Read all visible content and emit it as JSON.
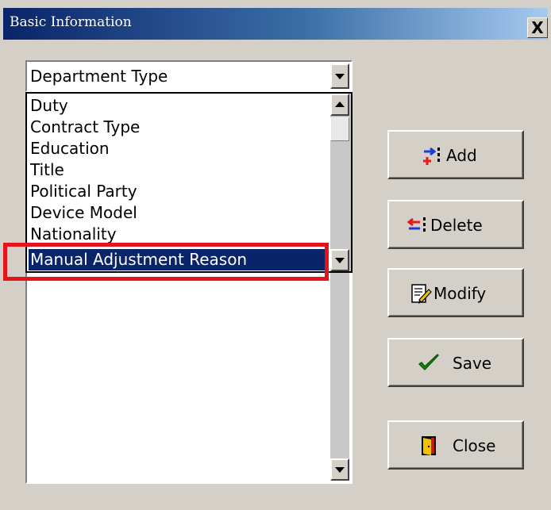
{
  "window": {
    "title": "Basic Information",
    "close_symbol": "X"
  },
  "combo": {
    "selected": "Department Type"
  },
  "dropdown": {
    "items": [
      "Duty",
      "Contract Type",
      "Education",
      "Title",
      "Political Party",
      "Device Model",
      "Nationality"
    ],
    "selected_item": "Manual Adjustment Reason"
  },
  "buttons": {
    "add": "Add",
    "delete": "Delete",
    "modify": "Modify",
    "save": "Save",
    "close": "Close"
  },
  "colors": {
    "highlight": "#e8121c",
    "selection": "#0a246a",
    "title_bar": "#0a246a"
  }
}
